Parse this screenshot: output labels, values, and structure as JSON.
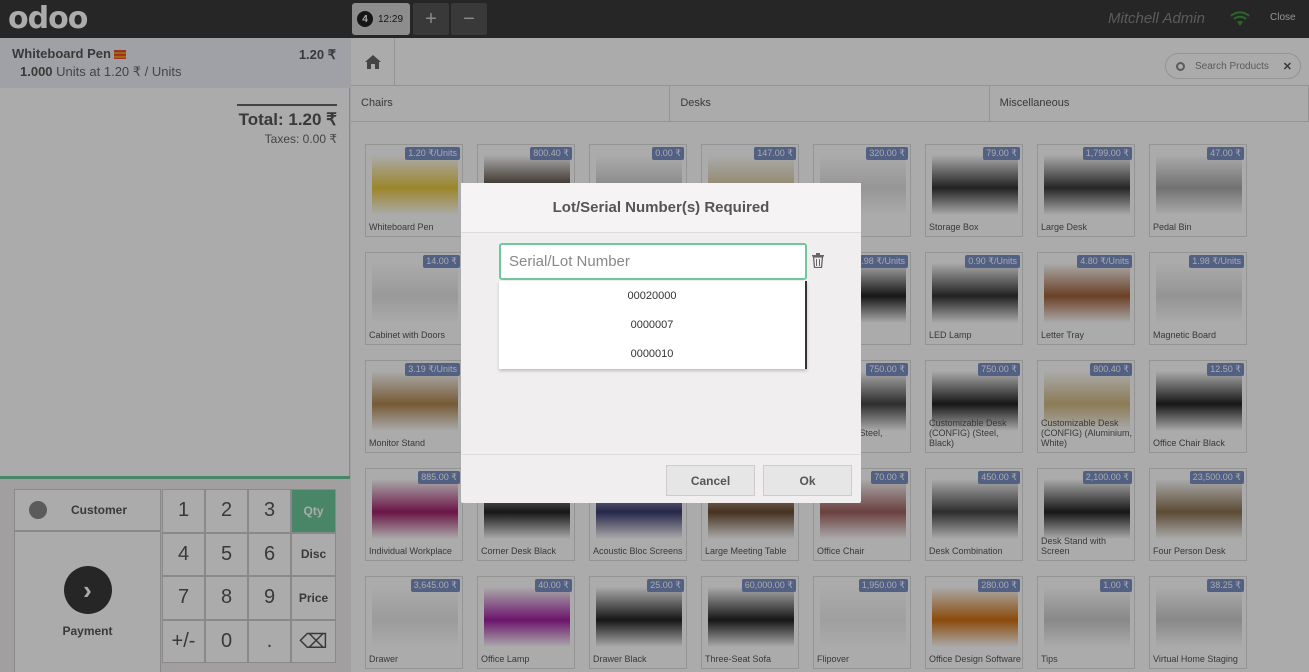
{
  "header": {
    "logo": "odoo",
    "order_tab": {
      "number": "4",
      "time": "12:29"
    },
    "add_order": "+",
    "remove_order": "−",
    "user": "Mitchell Admin",
    "close": "Close"
  },
  "orderline": {
    "name": "Whiteboard Pen",
    "price": "1.20 ₹",
    "qty": "1.000",
    "unit_info": "Units at 1.20 ₹ / Units"
  },
  "totals": {
    "total": "Total: 1.20 ₹",
    "taxes": "Taxes: 0.00 ₹"
  },
  "actionpad": {
    "customer": "Customer",
    "payment": "Payment"
  },
  "numpad": [
    {
      "label": "1"
    },
    {
      "label": "2"
    },
    {
      "label": "3"
    },
    {
      "label": "Qty",
      "mode": true,
      "active": true
    },
    {
      "label": "4"
    },
    {
      "label": "5"
    },
    {
      "label": "6"
    },
    {
      "label": "Disc",
      "mode": true
    },
    {
      "label": "7"
    },
    {
      "label": "8"
    },
    {
      "label": "9"
    },
    {
      "label": "Price",
      "mode": true
    },
    {
      "label": "+/-"
    },
    {
      "label": "0"
    },
    {
      "label": "."
    },
    {
      "label": "⌫"
    }
  ],
  "search": {
    "placeholder": "Search Products"
  },
  "categories": [
    "Chairs",
    "Desks",
    "Miscellaneous"
  ],
  "products": [
    {
      "name": "Whiteboard Pen",
      "price": "1.20 ₹/Units",
      "color": "#e8c840"
    },
    {
      "name": "",
      "price": "800.40 ₹",
      "color": "#4a3c30"
    },
    {
      "name": "",
      "price": "0.00 ₹",
      "color": "#cccccc"
    },
    {
      "name": "",
      "price": "147.00 ₹",
      "color": "#d9c9a0"
    },
    {
      "name": "net",
      "price": "320.00 ₹",
      "color": "#e0e0e0"
    },
    {
      "name": "Storage Box",
      "price": "79.00 ₹",
      "color": "#333333"
    },
    {
      "name": "Large Desk",
      "price": "1,799.00 ₹",
      "color": "#3a3a3a"
    },
    {
      "name": "Pedal Bin",
      "price": "47.00 ₹",
      "color": "#aaaaaa"
    },
    {
      "name": "Cabinet with Doors",
      "price": "14.00 ₹",
      "color": "#e5e5e5"
    },
    {
      "name": "",
      "price": "",
      "color": "#ffffff"
    },
    {
      "name": "",
      "price": "",
      "color": "#ffffff"
    },
    {
      "name": "",
      "price": "",
      "color": "#ffffff"
    },
    {
      "name": "",
      "price": "1.98 ₹/Units",
      "color": "#222222"
    },
    {
      "name": "LED Lamp",
      "price": "0.90 ₹/Units",
      "color": "#333333"
    },
    {
      "name": "Letter Tray",
      "price": "4.80 ₹/Units",
      "color": "#a0603a"
    },
    {
      "name": "Magnetic Board",
      "price": "1.98 ₹/Units",
      "color": "#dddddd"
    },
    {
      "name": "Monitor Stand",
      "price": "3.19 ₹/Units",
      "color": "#b08850"
    },
    {
      "name": "",
      "price": "",
      "color": "#ffffff"
    },
    {
      "name": "",
      "price": "",
      "color": "#ffffff"
    },
    {
      "name": "",
      "price": "",
      "color": "#ffffff"
    },
    {
      "name": "able Desk Steel, White)",
      "price": "750.00 ₹",
      "color": "#444444"
    },
    {
      "name": "Customizable Desk (CONFIG) (Steel, Black)",
      "price": "750.00 ₹",
      "color": "#222222"
    },
    {
      "name": "Customizable Desk (CONFIG) (Aluminium, White)",
      "price": "800.40 ₹",
      "color": "#d0b880"
    },
    {
      "name": "Office Chair Black",
      "price": "12.50 ₹",
      "color": "#222222"
    },
    {
      "name": "Individual Workplace",
      "price": "885.00 ₹",
      "color": "#a0206a"
    },
    {
      "name": "Corner Desk Black",
      "price": "",
      "color": "#222222"
    },
    {
      "name": "Acoustic Bloc Screens",
      "price": "",
      "color": "#3a3a70"
    },
    {
      "name": "Large Meeting Table",
      "price": "",
      "color": "#6a4a30"
    },
    {
      "name": "Office Chair",
      "price": "70.00 ₹",
      "color": "#a06060"
    },
    {
      "name": "Desk Combination",
      "price": "450.00 ₹",
      "color": "#444444"
    },
    {
      "name": "Desk Stand with Screen",
      "price": "2,100.00 ₹",
      "color": "#222222"
    },
    {
      "name": "Four Person Desk",
      "price": "23,500.00 ₹",
      "color": "#8a7050"
    },
    {
      "name": "Drawer",
      "price": "3,645.00 ₹",
      "color": "#e8e8e8"
    },
    {
      "name": "Office Lamp",
      "price": "40.00 ₹",
      "color": "#a020a0"
    },
    {
      "name": "Drawer Black",
      "price": "25.00 ₹",
      "color": "#222222"
    },
    {
      "name": "Three-Seat Sofa",
      "price": "60,000.00 ₹",
      "color": "#222222"
    },
    {
      "name": "Flipover",
      "price": "1,950.00 ₹",
      "color": "#eeeeee"
    },
    {
      "name": "Office Design Software",
      "price": "280.00 ₹",
      "color": "#d07010"
    },
    {
      "name": "Tips",
      "price": "1.00 ₹",
      "color": "#cccccc"
    },
    {
      "name": "Virtual Home Staging",
      "price": "38.25 ₹",
      "color": "#cccccc"
    }
  ],
  "dialog": {
    "title": "Lot/Serial Number(s) Required",
    "input_placeholder": "Serial/Lot Number",
    "options": [
      "00020000",
      "0000007",
      "0000010"
    ],
    "cancel": "Cancel",
    "ok": "Ok"
  },
  "colors": {
    "accent": "#6ec89b",
    "header": "#393939",
    "price_badge": "#7a8fc4"
  }
}
